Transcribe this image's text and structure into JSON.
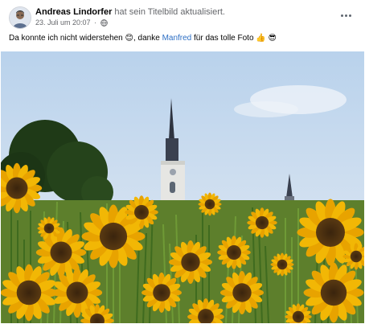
{
  "post": {
    "author": "Andreas Lindorfer",
    "action": "hat sein Titelbild aktualisiert.",
    "date": "23. Juli um 20:07",
    "audience_icon": "globe-icon",
    "more_icon": "more-horizontal-icon",
    "caption": {
      "text_before": "Da konnte ich nicht widerstehen",
      "emoji_1": "😊",
      "text_middle": ", danke",
      "mention": "Manfred",
      "text_after": "für das tolle Foto",
      "emoji_2": "👍",
      "emoji_3": "😎"
    }
  },
  "photo": {
    "subject": "sunflower-field-with-church-photo"
  },
  "colors": {
    "mention": "#2d6fc4",
    "meta": "#65676b",
    "sky": "#c9dbee"
  }
}
